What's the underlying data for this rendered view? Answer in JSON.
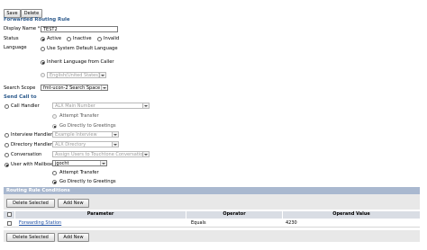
{
  "toolbar": {
    "save_label": "Save",
    "delete_label": "Delete"
  },
  "section_forwarded": {
    "title": "Forwarded Routing Rule",
    "display_name_label": "Display Name *",
    "display_name_value": "TEST2",
    "status_label": "Status",
    "status_options": [
      "Active",
      "Inactive",
      "Invalid"
    ],
    "language_label": "Language",
    "language_option_system": "Use System Default Language",
    "language_option_inherit": "Inherit Language from Caller",
    "language_select_value": "English(United States)",
    "search_scope_label": "Search Scope",
    "search_scope_value": "fmt-ucon-2 Search Space"
  },
  "section_send": {
    "title": "Send Call to",
    "call_handler_label": "Call Handler",
    "call_handler_value": "ALX Main Number",
    "attempt_transfer": "Attempt Transfer",
    "go_to_greetings": "Go Directly to Greetings",
    "interview_handler_label": "Interview Handler",
    "interview_handler_value": "Example Interview",
    "directory_handler_label": "Directory Handler",
    "directory_handler_value": "ALX Directory",
    "conversation_label": "Conversation",
    "conversation_value": "Assign Users to Touchtone Conversation",
    "user_mailbox_label": "User with Mailbox",
    "user_mailbox_value": "jgocht"
  },
  "conditions": {
    "title": "Routing Rule Conditions",
    "delete_selected_label": "Delete Selected",
    "add_new_label": "Add New",
    "columns": [
      "Parameter",
      "Operator",
      "Operand Value"
    ],
    "rows": [
      {
        "parameter": "Forwarding Station",
        "operator": "Equals",
        "operand": "4230"
      }
    ]
  }
}
